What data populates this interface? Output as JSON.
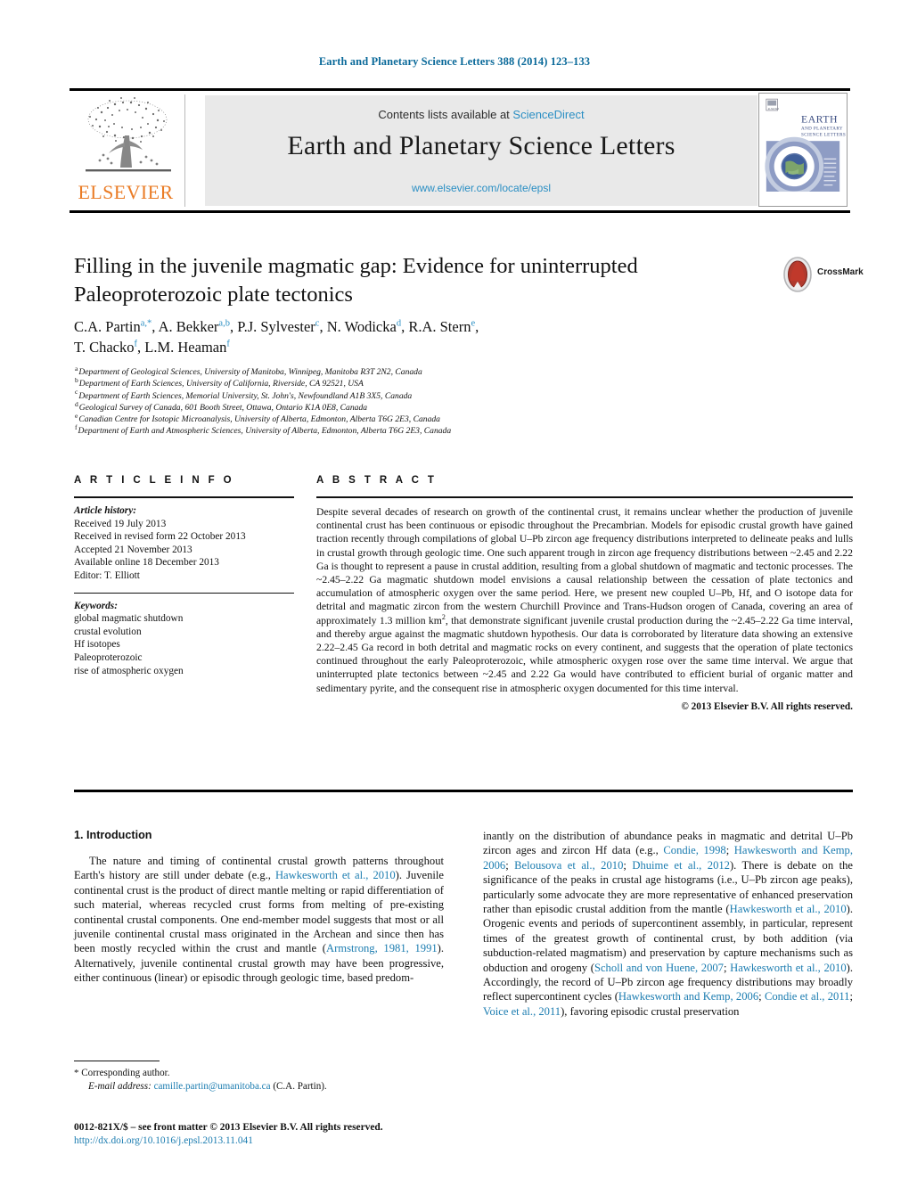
{
  "running_head": "Earth and Planetary Science Letters 388 (2014) 123–133",
  "masthead": {
    "contents_prefix": "Contents lists available at ",
    "sciencedirect": "ScienceDirect",
    "journal_title": "Earth and Planetary Science Letters",
    "journal_url": "www.elsevier.com/locate/epsl",
    "publisher": "ELSEVIER",
    "cover_title_line1": "EARTH",
    "cover_title_line2": "AND PLANETARY",
    "cover_title_line3": "SCIENCE LETTERS"
  },
  "article": {
    "title": "Filling in the juvenile magmatic gap: Evidence for uninterrupted Paleoproterozoic plate tectonics",
    "crossmark_label": "CrossMark",
    "authors_line1": "C.A. Partin <sup>a,*</sup>, A. Bekker <sup>a,b</sup>, P.J. Sylvester <sup>c</sup>, N. Wodicka <sup>d</sup>, R.A. Stern <sup>e</sup>,",
    "authors_line2": "T. Chacko <sup>f</sup>, L.M. Heaman <sup>f</sup>",
    "affiliations": [
      {
        "mark": "a",
        "text": "Department of Geological Sciences, University of Manitoba, Winnipeg, Manitoba R3T 2N2, Canada"
      },
      {
        "mark": "b",
        "text": "Department of Earth Sciences, University of California, Riverside, CA 92521, USA"
      },
      {
        "mark": "c",
        "text": "Department of Earth Sciences, Memorial University, St. John's, Newfoundland A1B 3X5, Canada"
      },
      {
        "mark": "d",
        "text": "Geological Survey of Canada, 601 Booth Street, Ottawa, Ontario K1A 0E8, Canada"
      },
      {
        "mark": "e",
        "text": "Canadian Centre for Isotopic Microanalysis, University of Alberta, Edmonton, Alberta T6G 2E3, Canada"
      },
      {
        "mark": "f",
        "text": "Department of Earth and Atmospheric Sciences, University of Alberta, Edmonton, Alberta T6G 2E3, Canada"
      }
    ]
  },
  "article_info": {
    "heading": "A R T I C L E   I N F O",
    "history_label": "Article history:",
    "history": [
      "Received 19 July 2013",
      "Received in revised form 22 October 2013",
      "Accepted 21 November 2013",
      "Available online 18 December 2013",
      "Editor: T. Elliott"
    ],
    "keywords_label": "Keywords:",
    "keywords": [
      "global magmatic shutdown",
      "crustal evolution",
      "Hf isotopes",
      "Paleoproterozoic",
      "rise of atmospheric oxygen"
    ]
  },
  "abstract": {
    "heading": "A B S T R A C T",
    "text": "Despite several decades of research on growth of the continental crust, it remains unclear whether the production of juvenile continental crust has been continuous or episodic throughout the Precambrian. Models for episodic crustal growth have gained traction recently through compilations of global U–Pb zircon age frequency distributions interpreted to delineate peaks and lulls in crustal growth through geologic time. One such apparent trough in zircon age frequency distributions between ~2.45 and 2.22 Ga is thought to represent a pause in crustal addition, resulting from a global shutdown of magmatic and tectonic processes. The ~2.45–2.22 Ga magmatic shutdown model envisions a causal relationship between the cessation of plate tectonics and accumulation of atmospheric oxygen over the same period. Here, we present new coupled U–Pb, Hf, and O isotope data for detrital and magmatic zircon from the western Churchill Province and Trans-Hudson orogen of Canada, covering an area of approximately 1.3 million km2, that demonstrate significant juvenile crustal production during the ~2.45–2.22 Ga time interval, and thereby argue against the magmatic shutdown hypothesis. Our data is corroborated by literature data showing an extensive 2.22–2.45 Ga record in both detrital and magmatic rocks on every continent, and suggests that the operation of plate tectonics continued throughout the early Paleoproterozoic, while atmospheric oxygen rose over the same time interval. We argue that uninterrupted plate tectonics between ~2.45 and 2.22 Ga would have contributed to efficient burial of organic matter and sedimentary pyrite, and the consequent rise in atmospheric oxygen documented for this time interval.",
    "copyright": "© 2013 Elsevier B.V. All rights reserved."
  },
  "body": {
    "section_heading": "1. Introduction",
    "left_paragraph": "The nature and timing of continental crustal growth patterns throughout Earth's history are still under debate (e.g., Hawkesworth et al., 2010). Juvenile continental crust is the product of direct mantle melting or rapid differentiation of such material, whereas recycled crust forms from melting of pre-existing continental crustal components. One end-member model suggests that most or all juvenile continental crustal mass originated in the Archean and since then has been mostly recycled within the crust and mantle (Armstrong, 1981, 1991). Alternatively, juvenile continental crustal growth may have been progressive, either continuous (linear) or episodic through geologic time, based predom-",
    "right_paragraph": "inantly on the distribution of abundance peaks in magmatic and detrital U–Pb zircon ages and zircon Hf data (e.g., Condie, 1998; Hawkesworth and Kemp, 2006; Belousova et al., 2010; Dhuime et al., 2012). There is debate on the significance of the peaks in crustal age histograms (i.e., U–Pb zircon age peaks), particularly some advocate they are more representative of enhanced preservation rather than episodic crustal addition from the mantle (Hawkesworth et al., 2010). Orogenic events and periods of supercontinent assembly, in particular, represent times of the greatest growth of continental crust, by both addition (via subduction-related magmatism) and preservation by capture mechanisms such as obduction and orogeny (Scholl and von Huene, 2007; Hawkesworth et al., 2010). Accordingly, the record of U–Pb zircon age frequency distributions may broadly reflect supercontinent cycles (Hawkesworth and Kemp, 2006; Condie et al., 2011; Voice et al., 2011), favoring episodic crustal preservation",
    "left_citations": [
      "Hawkesworth et al., 2010",
      "Armstrong, 1981, 1991"
    ],
    "right_citations": [
      "Condie, 1998",
      "Hawkesworth and Kemp, 2006",
      "Belousova et al., 2010",
      "Dhuime et al., 2012",
      "Hawkesworth et al., 2010",
      "Scholl and von Huene, 2007",
      "Hawkesworth et al., 2010",
      "Hawkesworth and Kemp, 2006",
      "Condie et al., 2011",
      "Voice et al., 2011"
    ]
  },
  "footnotes": {
    "corresponding": "Corresponding author.",
    "email_label": "E-mail address:",
    "email": "camille.partin@umanitoba.ca",
    "email_suffix": "(C.A. Partin).",
    "imprint": "0012-821X/$ – see front matter  © 2013 Elsevier B.V. All rights reserved.",
    "doi": "http://dx.doi.org/10.1016/j.epsl.2013.11.041"
  },
  "colors": {
    "link": "#1b7cb0",
    "running_head": "#0b6a9a",
    "sciencedirect": "#2b8fc4",
    "elsevier_orange": "#ea7c26",
    "masthead_bg": "#e9e9e9"
  }
}
